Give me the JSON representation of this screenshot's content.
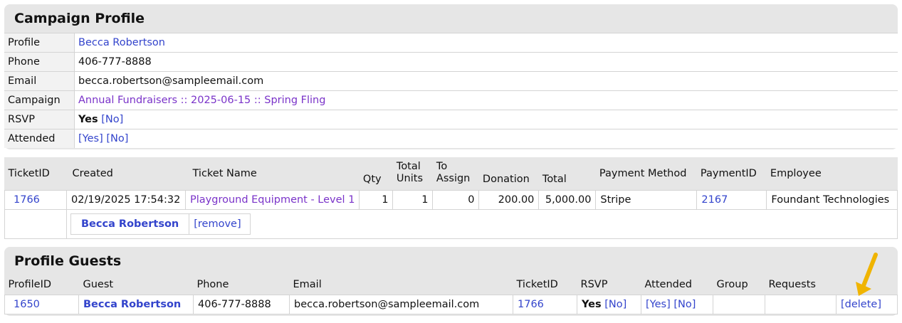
{
  "campaign_profile": {
    "title": "Campaign Profile",
    "rows": {
      "profile_label": "Profile",
      "profile_value": "Becca Robertson",
      "phone_label": "Phone",
      "phone_value": "406-777-8888",
      "email_label": "Email",
      "email_value": "becca.robertson@sampleemail.com",
      "campaign_label": "Campaign",
      "campaign_value": "Annual Fundraisers :: 2025-06-15 :: Spring Fling",
      "rsvp_label": "RSVP",
      "rsvp_yes": "Yes",
      "rsvp_no_link": "[No]",
      "attended_label": "Attended",
      "attended_yes_link": "[Yes]",
      "attended_no_link": "[No]"
    }
  },
  "tickets": {
    "headers": {
      "ticket_id": "TicketID",
      "created": "Created",
      "ticket_name": "Ticket Name",
      "qty": "Qty",
      "total_units_1": "Total",
      "total_units_2": "Units",
      "to_assign_1": "To",
      "to_assign_2": "Assign",
      "donation": "Donation",
      "total": "Total",
      "payment_method": "Payment Method",
      "payment_id": "PaymentID",
      "employee": "Employee"
    },
    "row": {
      "ticket_id": "1766",
      "created": "02/19/2025 17:54:32",
      "ticket_name": "Playground Equipment - Level 1",
      "qty": "1",
      "total_units": "1",
      "to_assign": "0",
      "donation": "200.00",
      "total": "5,000.00",
      "payment_method": "Stripe",
      "payment_id": "2167",
      "employee": "Foundant Technologies"
    },
    "assigned": {
      "name": "Becca Robertson",
      "remove_link": "[remove]"
    }
  },
  "profile_guests": {
    "title": "Profile Guests",
    "headers": {
      "profile_id": "ProfileID",
      "guest": "Guest",
      "phone": "Phone",
      "email": "Email",
      "ticket_id": "TicketID",
      "rsvp": "RSVP",
      "attended": "Attended",
      "group": "Group",
      "requests": "Requests"
    },
    "row": {
      "profile_id": "1650",
      "guest": "Becca Robertson",
      "phone": "406-777-8888",
      "email": "becca.robertson@sampleemail.com",
      "ticket_id": "1766",
      "rsvp_yes": "Yes",
      "rsvp_no_link": "[No]",
      "attended_yes_link": "[Yes]",
      "attended_no_link": "[No]",
      "group": "",
      "requests": "",
      "delete_link": "[delete]"
    }
  },
  "annotation": {
    "arrow_color": "#f0b400"
  }
}
